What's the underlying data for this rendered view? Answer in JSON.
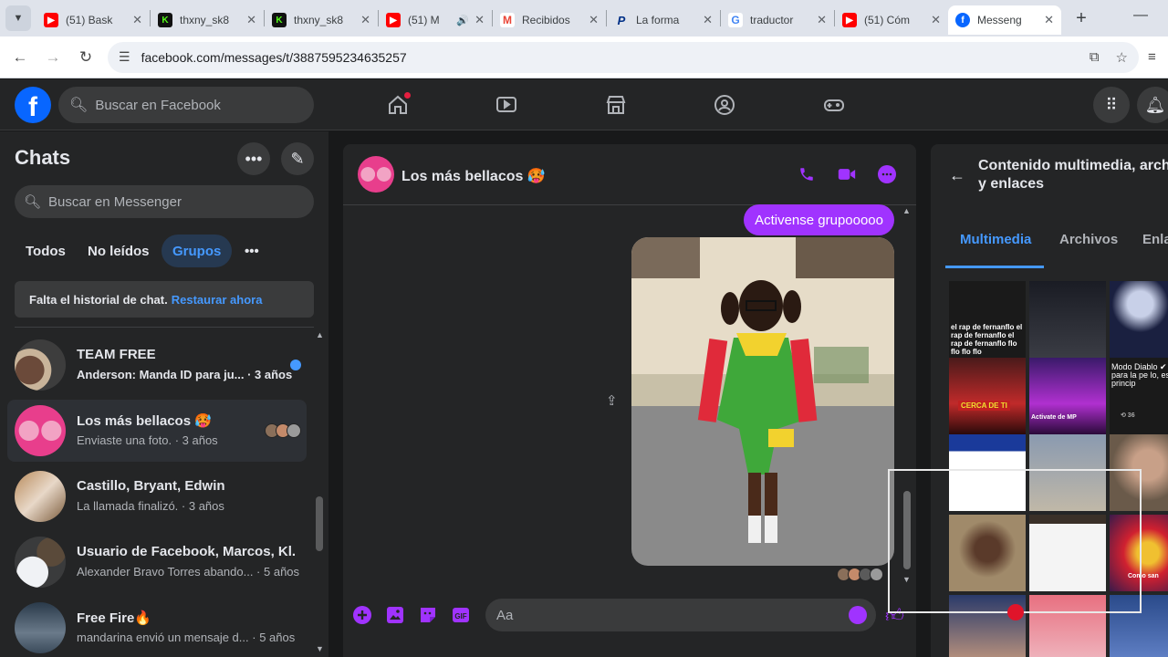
{
  "browser": {
    "tabs": [
      {
        "title": "(51) Bask",
        "icon": "youtube-icon",
        "color": "#ff0000"
      },
      {
        "title": "thxny_sk8",
        "icon": "kick-icon",
        "color": "#53fc18"
      },
      {
        "title": "thxny_sk8",
        "icon": "kick-icon",
        "color": "#53fc18"
      },
      {
        "title": "(51) M",
        "icon": "youtube-icon",
        "color": "#ff0000"
      },
      {
        "title": "Recibidos",
        "icon": "gmail-icon",
        "color": "#ea4335"
      },
      {
        "title": "La forma",
        "icon": "paypal-icon",
        "color": "#003087"
      },
      {
        "title": "traductor",
        "icon": "google-icon",
        "color": "#4285f4"
      },
      {
        "title": "(51) Cóm",
        "icon": "youtube-icon",
        "color": "#ff0000"
      },
      {
        "title": "Messeng",
        "icon": "facebook-icon",
        "color": "#0866ff"
      }
    ],
    "url": "facebook.com/messages/t/3887595234635257"
  },
  "fb": {
    "search_placeholder": "Buscar en Facebook"
  },
  "sidebar": {
    "title": "Chats",
    "search_placeholder": "Buscar en Messenger",
    "filters": [
      "Todos",
      "No leídos",
      "Grupos"
    ],
    "selected_filter": "Grupos",
    "banner_text": "Falta el historial de chat.",
    "banner_link": "Restaurar ahora",
    "conversations": [
      {
        "name": "TEAM FREE",
        "preview": "Anderson: Manda ID para ju...",
        "time": "3 años",
        "unread": true
      },
      {
        "name": "Los más bellacos 🥵",
        "preview": "Enviaste una foto.",
        "time": "3 años",
        "selected": true
      },
      {
        "name": "Castillo, Bryant, Edwin",
        "preview": "La llamada finalizó.",
        "time": "3 años"
      },
      {
        "name": "Usuario de Facebook, Marcos, Kl...",
        "preview": "Alexander Bravo Torres abando...",
        "time": "5 años"
      },
      {
        "name": "Free Fire🔥",
        "preview": "mandarina envió un mensaje d...",
        "time": "5 años"
      }
    ]
  },
  "chat": {
    "name": "Los más bellacos 🥵",
    "message": "Activense grupooooo",
    "composer_placeholder": "Aa",
    "accent": "#a033ff"
  },
  "media": {
    "title_line1": "Contenido multimedia, arch",
    "title_line2": "y enlaces",
    "tabs": [
      "Multimedia",
      "Archivos",
      "Enla"
    ],
    "selected_tab": "Multimedia",
    "thumb_captions": {
      "t1": "el rap de fernanflo el rap de fernanflo el rap de fernanflo flo flo flo flo",
      "t4": "CERCA DE TI",
      "t5": "Activate de MP",
      "t6": "Modo Diablo ✔ listo para la pe lo, es el princip",
      "t6b": "⟲ 36",
      "t12": "Como san"
    }
  }
}
